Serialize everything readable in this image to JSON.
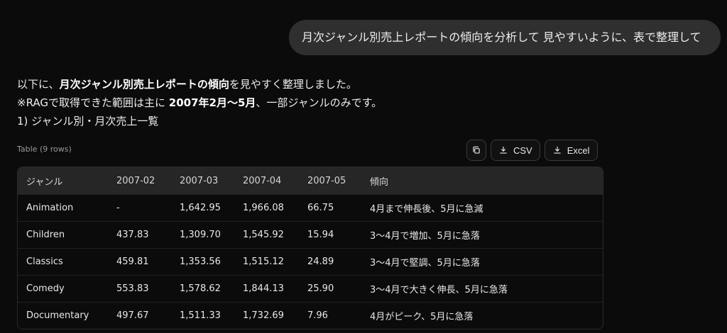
{
  "conversation": {
    "user_message": "月次ジャンル別売上レポートの傾向を分析して 見やすいように、表で整理して",
    "response": {
      "line1_prefix": "以下に、",
      "line1_strong": "月次ジャンル別売上レポートの傾向",
      "line1_suffix": "を見やすく整理しました。",
      "line2_prefix": "※RAGで取得できた範囲は主に ",
      "line2_strong": "2007年2月〜5月",
      "line2_suffix": "、一部ジャンルのみです。",
      "line3": "1) ジャンル別・月次売上一覧"
    }
  },
  "table": {
    "caption": "Table (9 rows)",
    "actions": {
      "copy_icon": "copy-icon",
      "csv_label": "CSV",
      "excel_label": "Excel",
      "download_icon": "download-icon"
    },
    "headers": [
      "ジャンル",
      "2007-02",
      "2007-03",
      "2007-04",
      "2007-05",
      "傾向"
    ],
    "rows": [
      [
        "Animation",
        "-",
        "1,642.95",
        "1,966.08",
        "66.75",
        "4月まで伸長後、5月に急減"
      ],
      [
        "Children",
        "437.83",
        "1,309.70",
        "1,545.92",
        "15.94",
        "3〜4月で増加、5月に急落"
      ],
      [
        "Classics",
        "459.81",
        "1,353.56",
        "1,515.12",
        "24.89",
        "3〜4月で堅調、5月に急落"
      ],
      [
        "Comedy",
        "553.83",
        "1,578.62",
        "1,844.13",
        "25.90",
        "3〜4月で大きく伸長、5月に急落"
      ],
      [
        "Documentary",
        "497.67",
        "1,511.33",
        "1,732.69",
        "7.96",
        "4月がピーク、5月に急落"
      ]
    ]
  }
}
